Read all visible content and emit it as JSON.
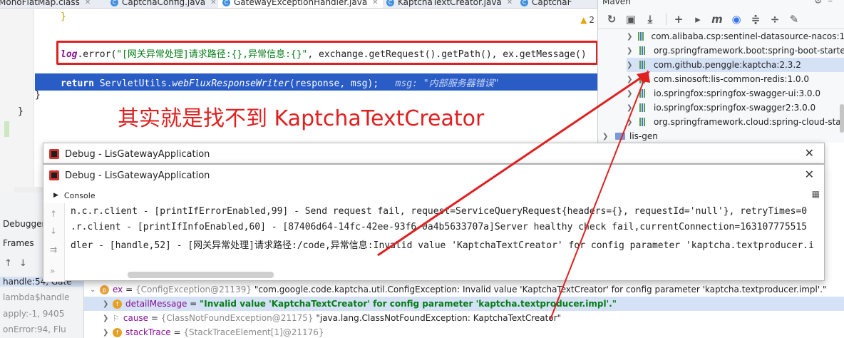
{
  "tabs": [
    {
      "label": "MonoFlatMap.class",
      "active": false
    },
    {
      "label": "CaptchaConfig.java",
      "active": false
    },
    {
      "label": "GatewayExceptionHandler.java",
      "active": true
    },
    {
      "label": "KaptchaTextCreator.java",
      "active": false
    },
    {
      "label": "CaptchaF",
      "active": false
    }
  ],
  "editor": {
    "warning_count": "2",
    "lines": {
      "brace_top": "}",
      "log_obj": "log",
      "log_call": ".error(",
      "log_str": "\"[网关异常处理]请求路径:{},异常信息:{}\"",
      "log_rest": ", exchange.getRequest().getPath(), ex.getMessage()",
      "return_kw": "return",
      "return_cls": " ServletUtils.",
      "return_method": "webFluxResponseWriter",
      "return_args": "(response, msg);",
      "return_hint": "msg: \"内部服务器错误\"",
      "brace_inner": "}",
      "brace_outer": "}"
    },
    "annotation": "其实就是找不到 KaptchaTextCreator"
  },
  "maven": {
    "title": "Maven",
    "toolbar": [
      "refresh-icon",
      "folder-icon",
      "download-icon",
      "add-icon",
      "run-icon",
      "m-icon",
      "skip-tests-icon",
      "collapse-icon",
      "expand-icon",
      "wrench-icon"
    ],
    "items": [
      {
        "label": "com.alibaba.csp:sentinel-datasource-nacos:1.",
        "selected": false
      },
      {
        "label": "org.springframework.boot:spring-boot-starte",
        "selected": false
      },
      {
        "label": "com.github.penggle:kaptcha:2.3.2",
        "selected": true
      },
      {
        "label": "com.sinosoft:lis-common-redis:1.0.0",
        "selected": false
      },
      {
        "label": "io.springfox:springfox-swagger-ui:3.0.0",
        "selected": false
      },
      {
        "label": "io.springfox:springfox-swagger2:3.0.0",
        "selected": false
      },
      {
        "label": "org.springframework.cloud:spring-cloud-star",
        "selected": false
      }
    ],
    "module": "lis-gen"
  },
  "debugger": {
    "tab": "Debugger",
    "frames_label": "Frames",
    "frames": [
      {
        "label": "handle:54, Gate",
        "current": true
      },
      {
        "label": "lambda$handle",
        "current": false
      },
      {
        "label": "apply:-1, 9405",
        "current": false
      },
      {
        "label": "onError:94, Flu",
        "current": false
      }
    ]
  },
  "popup": {
    "title_back": "Debug - LisGatewayApplication",
    "title_front": "Debug - LisGatewayApplication",
    "console_label": "Console",
    "lines": [
      "n.c.r.client - [printIfErrorEnabled,99] - Send request fail, request=ServiceQueryRequest{headers={}, requestId='null'}, retryTimes=0",
      ".r.client - [printIfInfoEnabled,60] - [87406d64-14fc-42ee-93f6-0a4b5633707a]Server healthy check fail,currentConnection=163107775515",
      "dler - [handle,52] - [网关异常处理]请求路径:/code,异常信息:Invalid value 'KaptchaTextCreator' for config parameter 'kaptcha.textproducer.i"
    ]
  },
  "variables": [
    {
      "badge": "p",
      "name": "ex",
      "ref": "{ConfigException@21139}",
      "value": "\"com.google.code.kaptcha.util.ConfigException: Invalid value 'KaptchaTextCreator' for config parameter 'kaptcha.textproducer.impl'.\"",
      "selected": false,
      "indent": 0
    },
    {
      "badge": "f",
      "name": "detailMessage",
      "ref": "",
      "value": "\"Invalid value 'KaptchaTextCreator' for config parameter 'kaptcha.textproducer.impl'.\"",
      "selected": true,
      "indent": 1
    },
    {
      "badge": "flag",
      "name": "cause",
      "ref": "{ClassNotFoundException@21175}",
      "value": "\"java.lang.ClassNotFoundException: KaptchaTextCreator\"",
      "selected": false,
      "indent": 1
    },
    {
      "badge": "f",
      "name": "stackTrace",
      "ref": "{StackTraceElement[1]@21176}",
      "value": "",
      "selected": false,
      "indent": 1
    }
  ],
  "colors": {
    "annotation_red": "#e02020",
    "selection_blue": "#2a5cc6"
  }
}
